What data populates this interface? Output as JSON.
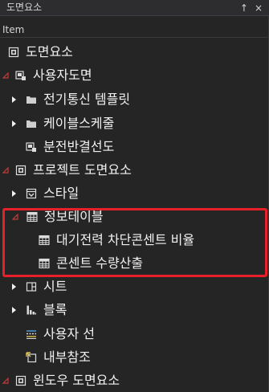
{
  "window": {
    "title": "도면요소",
    "pin_glyph": "↑",
    "close_glyph": "×"
  },
  "header": {
    "label": "Item"
  },
  "colors": {
    "accent_red": "#e8202a",
    "expander_expanded": "#c53a3a",
    "text": "#f1f1f1"
  },
  "tree": [
    {
      "id": "row-0",
      "label": "도면요소",
      "icon": "drawing-element-icon",
      "expander": "none"
    },
    {
      "id": "row-1",
      "label": "사용자도면",
      "icon": "user-drawing-icon",
      "expander": "expanded"
    },
    {
      "id": "row-2",
      "label": "전기통신 템플릿",
      "icon": "folder-icon",
      "expander": "collapsed"
    },
    {
      "id": "row-3",
      "label": "케이블스케줄",
      "icon": "folder-icon",
      "expander": "collapsed"
    },
    {
      "id": "row-4",
      "label": "분전반결선도",
      "icon": "user-drawing-icon",
      "expander": "none"
    },
    {
      "id": "row-5",
      "label": "프로젝트 도면요소",
      "icon": "project-element-icon",
      "expander": "expanded"
    },
    {
      "id": "row-6",
      "label": "스타일",
      "icon": "style-icon",
      "expander": "collapsed"
    },
    {
      "id": "row-7",
      "label": "정보테이블",
      "icon": "table-icon",
      "expander": "expanded"
    },
    {
      "id": "row-8",
      "label": "대기전력 차단콘센트 비율",
      "icon": "table-icon",
      "expander": "none"
    },
    {
      "id": "row-9",
      "label": "콘센트 수량산출",
      "icon": "table-icon",
      "expander": "none"
    },
    {
      "id": "row-10",
      "label": "시트",
      "icon": "sheet-icon",
      "expander": "collapsed"
    },
    {
      "id": "row-11",
      "label": "블록",
      "icon": "block-icon",
      "expander": "collapsed"
    },
    {
      "id": "row-12",
      "label": "사용자 선",
      "icon": "user-line-icon",
      "expander": "none"
    },
    {
      "id": "row-13",
      "label": "내부참조",
      "icon": "xref-icon",
      "expander": "none"
    },
    {
      "id": "row-14",
      "label": "윈도우 도면요소",
      "icon": "window-element-icon",
      "expander": "expanded"
    }
  ]
}
